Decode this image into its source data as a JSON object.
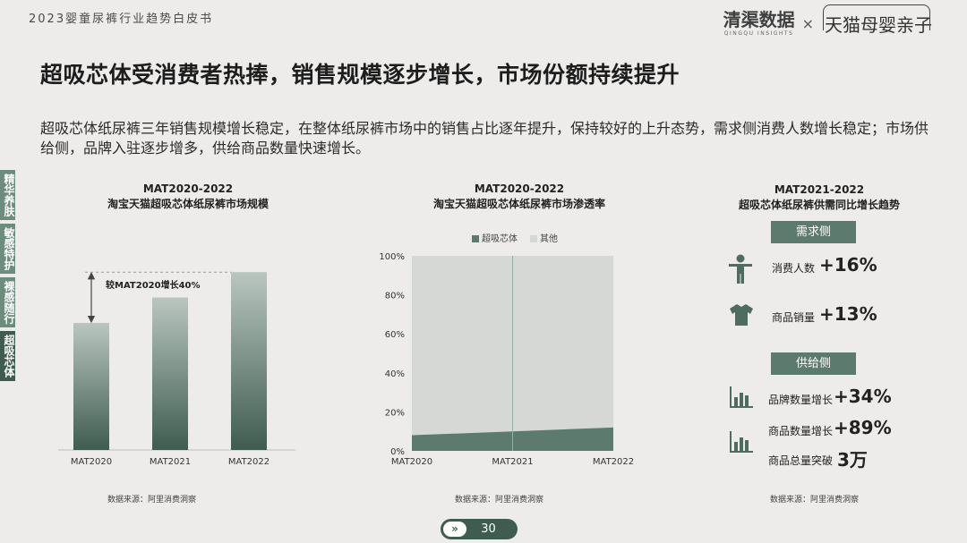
{
  "header": {
    "report_title": "2023婴童尿裤行业趋势白皮书",
    "brand_a": "清渠数据",
    "brand_a_sub": "QINGQU INSIGHTS",
    "brand_x": "×",
    "brand_b": "天猫母婴亲子"
  },
  "headline": "超吸芯体受消费者热捧，销售规模逐步增长，市场份额持续提升",
  "intro": "超吸芯体纸尿裤三年销售规模增长稳定，在整体纸尿裤市场中的销售占比逐年提升，保持较好的上升态势，需求侧消费人数增长稳定；市场供给侧，品牌入驻逐步增多，供给商品数量快速增长。",
  "sidenav": [
    {
      "label": "精华养肤",
      "active": false
    },
    {
      "label": "敏感特护",
      "active": false
    },
    {
      "label": "裸感随行",
      "active": false
    },
    {
      "label": "超吸芯体",
      "active": true
    }
  ],
  "colors": {
    "dark_green": "#3f5c50",
    "mid_green": "#5d7a6e",
    "light_green": "#c7d1cc",
    "area_fill": "#d6d8d6",
    "accent": "#6d8c7e"
  },
  "panel1": {
    "period": "MAT2020-2022",
    "title": "淘宝天猫超吸芯体纸尿裤市场规模",
    "annotation": "较MAT2020增长40%",
    "source": "数据来源：阿里消费洞察"
  },
  "panel2": {
    "period": "MAT2020-2022",
    "title": "淘宝天猫超吸芯体纸尿裤市场渗透率",
    "legend": [
      "超吸芯体",
      "其他"
    ],
    "source": "数据来源：阿里消费洞察"
  },
  "panel3": {
    "period": "MAT2021-2022",
    "title": "超吸芯体纸尿裤供需同比增长趋势",
    "demand_tag": "需求侧",
    "supply_tag": "供给侧",
    "metrics": {
      "consumers_label": "消费人数",
      "consumers_value": "+16%",
      "sales_label": "商品销量",
      "sales_value": "+13%",
      "brands_label": "品牌数量增长",
      "brands_value": "+34%",
      "products_label": "商品数量增长",
      "products_value": "+89%",
      "total_label": "商品总量突破",
      "total_value": "3万"
    },
    "icons": [
      "person-icon",
      "tshirt-icon",
      "bar-chart-icon",
      "bar-chart-icon"
    ],
    "source": "数据来源：阿里消费洞察"
  },
  "pager": {
    "arrow": "»",
    "page": "30"
  },
  "chart_data": [
    {
      "type": "bar",
      "title": "淘宝天猫超吸芯体纸尿裤市场规模",
      "categories": [
        "MAT2020",
        "MAT2021",
        "MAT2022"
      ],
      "values": [
        100,
        120,
        140
      ],
      "annotation": "较MAT2020增长40%",
      "ylim": [
        0,
        150
      ]
    },
    {
      "type": "area",
      "title": "淘宝天猫超吸芯体纸尿裤市场渗透率",
      "categories": [
        "MAT2020",
        "MAT2021",
        "MAT2022"
      ],
      "yticks": [
        "0%",
        "20%",
        "40%",
        "60%",
        "80%",
        "100%"
      ],
      "ylim": [
        0,
        100
      ],
      "series": [
        {
          "name": "超吸芯体",
          "values": [
            8,
            10,
            12
          ]
        },
        {
          "name": "其他",
          "values": [
            92,
            90,
            88
          ]
        }
      ],
      "legend": "top"
    }
  ]
}
